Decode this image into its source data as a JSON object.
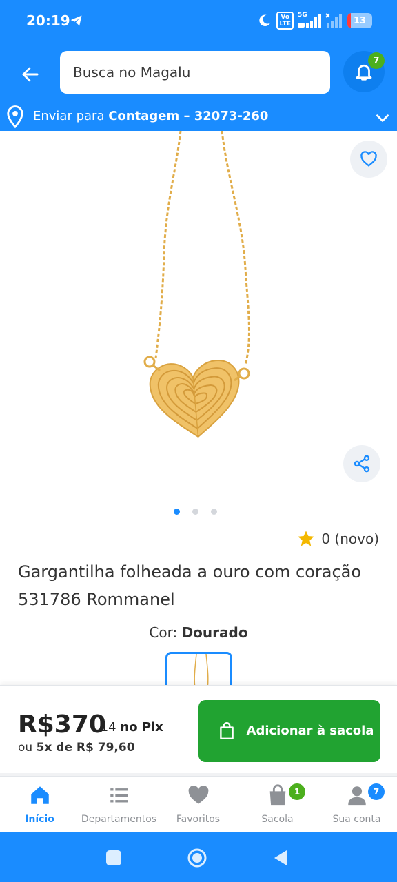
{
  "status_bar": {
    "time": "20:19",
    "battery_level": "13",
    "network": "5G"
  },
  "header": {
    "search_placeholder": "Busca no Magalu",
    "notification_count": "7"
  },
  "shipping": {
    "prefix": "Enviar para",
    "location": "Contagem – 32073-260"
  },
  "gallery": {
    "image_count": 3,
    "active_index": 0
  },
  "rating": {
    "text": "0 (novo)"
  },
  "product": {
    "title": "Gargantilha folheada a ouro com coração 531786 Rommanel",
    "color_label": "Cor:",
    "color_value": "Dourado"
  },
  "price": {
    "main": "R$370",
    "cents": ",14",
    "pix_label": "no Pix",
    "installment_prefix": "ou",
    "installment": "5x de R$ 79,60"
  },
  "add_button": {
    "label": "Adicionar à sacola"
  },
  "bottom_nav": {
    "items": [
      {
        "label": "Início",
        "icon": "home-icon",
        "active": true
      },
      {
        "label": "Departamentos",
        "icon": "list-icon"
      },
      {
        "label": "Favoritos",
        "icon": "heart-icon"
      },
      {
        "label": "Sacola",
        "icon": "bag-icon",
        "badge": "1"
      },
      {
        "label": "Sua conta",
        "icon": "user-icon",
        "badge": "7"
      }
    ]
  },
  "colors": {
    "brand_blue": "#1a8cff",
    "buy_green": "#21a331",
    "badge_green": "#4caf1d",
    "gold": "#e8b44e"
  }
}
